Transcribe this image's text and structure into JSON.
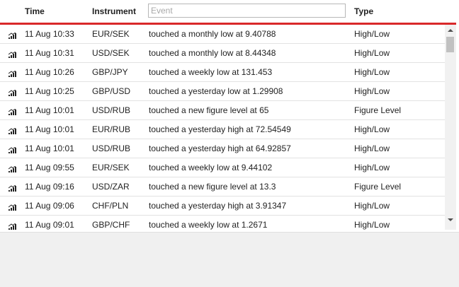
{
  "header": {
    "time_label": "Time",
    "instrument_label": "Instrument",
    "event_placeholder": "Event",
    "event_value": "",
    "type_label": "Type"
  },
  "accent_color": "#d9292a",
  "rows": [
    {
      "icon": "signal-strength-icon",
      "time": "11 Aug 10:33",
      "instrument": "EUR/SEK",
      "event": "touched a monthly low at 9.40788",
      "type": "High/Low"
    },
    {
      "icon": "signal-strength-icon",
      "time": "11 Aug 10:31",
      "instrument": "USD/SEK",
      "event": "touched a monthly low at 8.44348",
      "type": "High/Low"
    },
    {
      "icon": "signal-strength-icon",
      "time": "11 Aug 10:26",
      "instrument": "GBP/JPY",
      "event": "touched a weekly low at 131.453",
      "type": "High/Low"
    },
    {
      "icon": "signal-strength-icon",
      "time": "11 Aug 10:25",
      "instrument": "GBP/USD",
      "event": "touched a yesterday low at 1.29908",
      "type": "High/Low"
    },
    {
      "icon": "signal-strength-icon",
      "time": "11 Aug 10:01",
      "instrument": "USD/RUB",
      "event": "touched a new figure level at 65",
      "type": "Figure Level"
    },
    {
      "icon": "signal-strength-icon",
      "time": "11 Aug 10:01",
      "instrument": "EUR/RUB",
      "event": "touched a yesterday high at 72.54549",
      "type": "High/Low"
    },
    {
      "icon": "signal-strength-icon",
      "time": "11 Aug 10:01",
      "instrument": "USD/RUB",
      "event": "touched a yesterday high at 64.92857",
      "type": "High/Low"
    },
    {
      "icon": "signal-strength-icon",
      "time": "11 Aug 09:55",
      "instrument": "EUR/SEK",
      "event": "touched a weekly low at 9.44102",
      "type": "High/Low"
    },
    {
      "icon": "signal-strength-icon",
      "time": "11 Aug 09:16",
      "instrument": "USD/ZAR",
      "event": "touched a new figure level at 13.3",
      "type": "Figure Level"
    },
    {
      "icon": "signal-strength-icon",
      "time": "11 Aug 09:06",
      "instrument": "CHF/PLN",
      "event": "touched a yesterday high at 3.91347",
      "type": "High/Low"
    },
    {
      "icon": "signal-strength-icon",
      "time": "11 Aug 09:01",
      "instrument": "GBP/CHF",
      "event": "touched a weekly low at 1.2671",
      "type": "High/Low"
    }
  ]
}
